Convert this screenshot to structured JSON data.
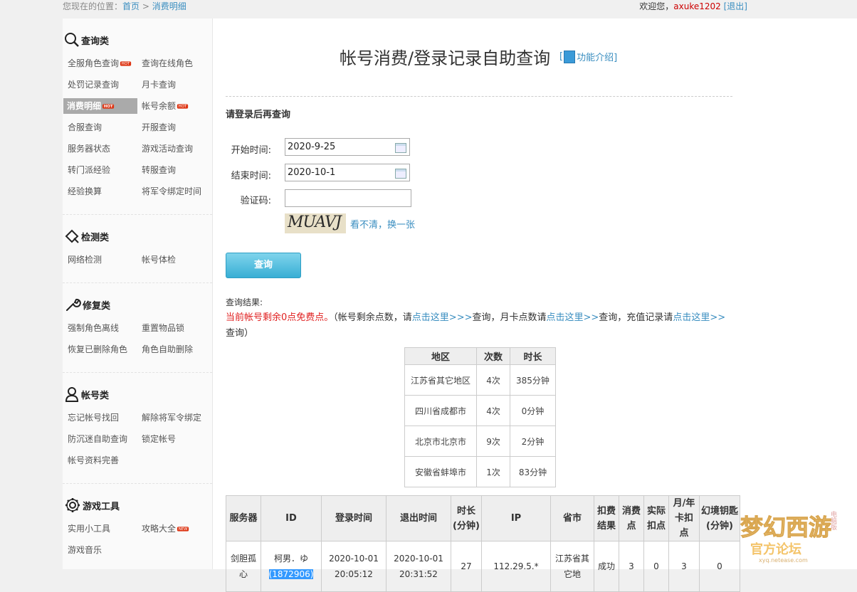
{
  "topbar": {
    "location_prefix": "您现在的位置：",
    "crumb_home": "首页",
    "crumb_sep": " > ",
    "crumb_current": "消费明细",
    "welcome": "欢迎您，",
    "username": "axuke1202",
    "logout": "[退出]"
  },
  "sidebar": {
    "query": {
      "title": "查询类",
      "items": [
        "全服角色查询",
        "查询在线角色",
        "处罚记录查询",
        "月卡查询",
        "消费明细",
        "帐号余额",
        "合服查询",
        "开服查询",
        "服务器状态",
        "游戏活动查询",
        "转门派经验",
        "转服查询",
        "经验换算",
        "将军令绑定时间"
      ]
    },
    "detect": {
      "title": "检测类",
      "items": [
        "网络检测",
        "帐号体检"
      ]
    },
    "repair": {
      "title": "修复类",
      "items": [
        "强制角色离线",
        "重置物品锁",
        "恢复已删除角色",
        "角色自助删除"
      ]
    },
    "account": {
      "title": "帐号类",
      "items": [
        "忘记帐号找回",
        "解除将军令绑定",
        "防沉迷自助查询",
        "锁定帐号",
        "帐号资料完善"
      ]
    },
    "tools": {
      "title": "游戏工具",
      "items": [
        "实用小工具",
        "攻略大全",
        "游戏音乐"
      ]
    },
    "hot_badge": "HOT",
    "new_badge": "NEW"
  },
  "main": {
    "title": "帐号消费/登录记录自助查询",
    "intro_bracket_open": "[",
    "intro": "功能介绍]",
    "login_tip": "请登录后再查询",
    "form": {
      "start_label": "开始时间:",
      "start_value": "2020-9-25",
      "end_label": "结束时间:",
      "end_value": "2020-10-1",
      "captcha_label": "验证码:",
      "captcha_value": "",
      "captcha_image_text": "MUAVJ",
      "refresh": "看不清，换一张",
      "submit": "查询"
    },
    "result": {
      "label": "查询结果:",
      "free_points": "当前帐号剩余0点免费点。",
      "t1": "（帐号剩余点数，请",
      "link1": "点击这里>>>",
      "t2": "查询，月卡点数请",
      "link2": "点击这里>>",
      "t3": "查询，充值记录请",
      "link3": "点击这里>>",
      "t4": "查询）"
    },
    "region_table": {
      "headers": [
        "地区",
        "次数",
        "时长"
      ],
      "rows": [
        [
          "江苏省其它地区",
          "4次",
          "385分钟"
        ],
        [
          "四川省成都市",
          "4次",
          "0分钟"
        ],
        [
          "北京市北京市",
          "9次",
          "2分钟"
        ],
        [
          "安徽省蚌埠市",
          "1次",
          "83分钟"
        ]
      ]
    },
    "login_table": {
      "headers": [
        "服务器",
        "ID",
        "登录时间",
        "退出时间",
        "时长(分钟)",
        "IP",
        "省市",
        "扣费结果",
        "消费点",
        "实际扣点",
        "月/年卡扣点",
        "幻境钥匙(分钟)"
      ],
      "row": {
        "server": "剑胆孤心",
        "id_name": "柯男．ゆ",
        "id_num": "(1872906)",
        "login": "2020-10-01 20:05:12",
        "logout": "2020-10-01 20:31:52",
        "duration": "27",
        "ip": "112.29.5.*",
        "region": "江苏省其它地",
        "result": "成功",
        "points": "3",
        "actual": "0",
        "monthly": "3",
        "key": "0"
      }
    }
  },
  "watermark": {
    "title": "梦幻西游",
    "sub": "官方论坛",
    "badge": "电脑版",
    "url": "xyq.netease.com"
  }
}
